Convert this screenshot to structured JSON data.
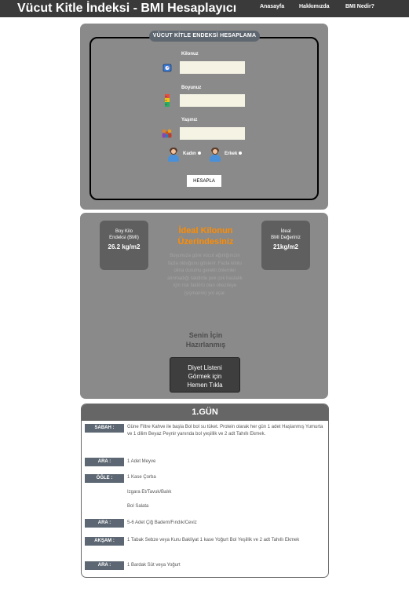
{
  "header": {
    "title": "Vücut Kitle İndeksi - BMI Hesaplayıcı",
    "nav": [
      {
        "label": "Anasayfa"
      },
      {
        "label": "Hakkımızda"
      },
      {
        "label": "BMI Nedir?"
      }
    ]
  },
  "form": {
    "legend": "VÜCUT KİTLE ENDEKSİ HESAPLAMA",
    "weight_label": "Kilonuz",
    "height_label": "Boyunuz",
    "age_label": "Yaşınız",
    "weight_value": "",
    "height_value": "",
    "age_value": "",
    "gender_female": "Kadın",
    "gender_male": "Erkek",
    "submit_label": "HESAPLA",
    "icons": {
      "weight": "scale-icon",
      "height": "ruler-icon",
      "age": "people-icon",
      "female": "woman-avatar-icon",
      "male": "man-avatar-icon"
    }
  },
  "result": {
    "bmi_label_line1": "Boy Kilo",
    "bmi_label_line2": "Endeksi (BMI)",
    "bmi_value": "26.2 kg/m2",
    "ideal_label_line1": "İdeal",
    "ideal_label_line2": "BMI Değeriniz",
    "ideal_value": "21kg/m2",
    "status_line1": "İdeal Kilonun",
    "status_line2": "Üzerindesiniz",
    "description": "Boyunuza göre vücut ağırlığınızın fazla olduğunu gösterir. Fazla kilolu olma durumu gerekli önlemler alınmadığı takdirde pek çok hastalık için risk faktörü olan obeziteye (şişmanlık) yol açar.",
    "ready_line1": "Senin İçin",
    "ready_line2": "Hazırlanmış",
    "diet_button_line1": "Diyet Listeni",
    "diet_button_line2": "Görmek için",
    "diet_button_line3": "Hemen Tıkla",
    "status_color": "#ff8c00"
  },
  "diet": {
    "day_title": "1.GÜN",
    "meals": [
      {
        "label": "SABAH :",
        "text": "Güne Filtre Kahve ile başla Bol bol su tüket. Protein olarak her gün 1 adet Haşlanmış Yumurta ve 1 dilim Beyaz Peynir yanında bol yeşillik ve 2 adt Tahıllı Ekmek."
      },
      {
        "label": "ARA :",
        "text": "1 Adet Meyve"
      },
      {
        "label": "ÖĞLE :",
        "text": "1 Kase Çorba"
      },
      {
        "label": "",
        "text": "Izgara Et/Tavuk/Balık"
      },
      {
        "label": "",
        "text": "Bol Salata"
      },
      {
        "label": "ARA :",
        "text": "5-6 Adet Çiğ Badem/Fındık/Ceviz"
      },
      {
        "label": "AKŞAM :",
        "text": "1 Tabak Sebze veya Kuru Bakliyat 1 kase Yoğurt Bol Yeşillik ve 2 adt Tahıllı Ekmek"
      },
      {
        "label": "ARA :",
        "text": "1 Bardak Süt veya Yoğurt"
      }
    ]
  }
}
